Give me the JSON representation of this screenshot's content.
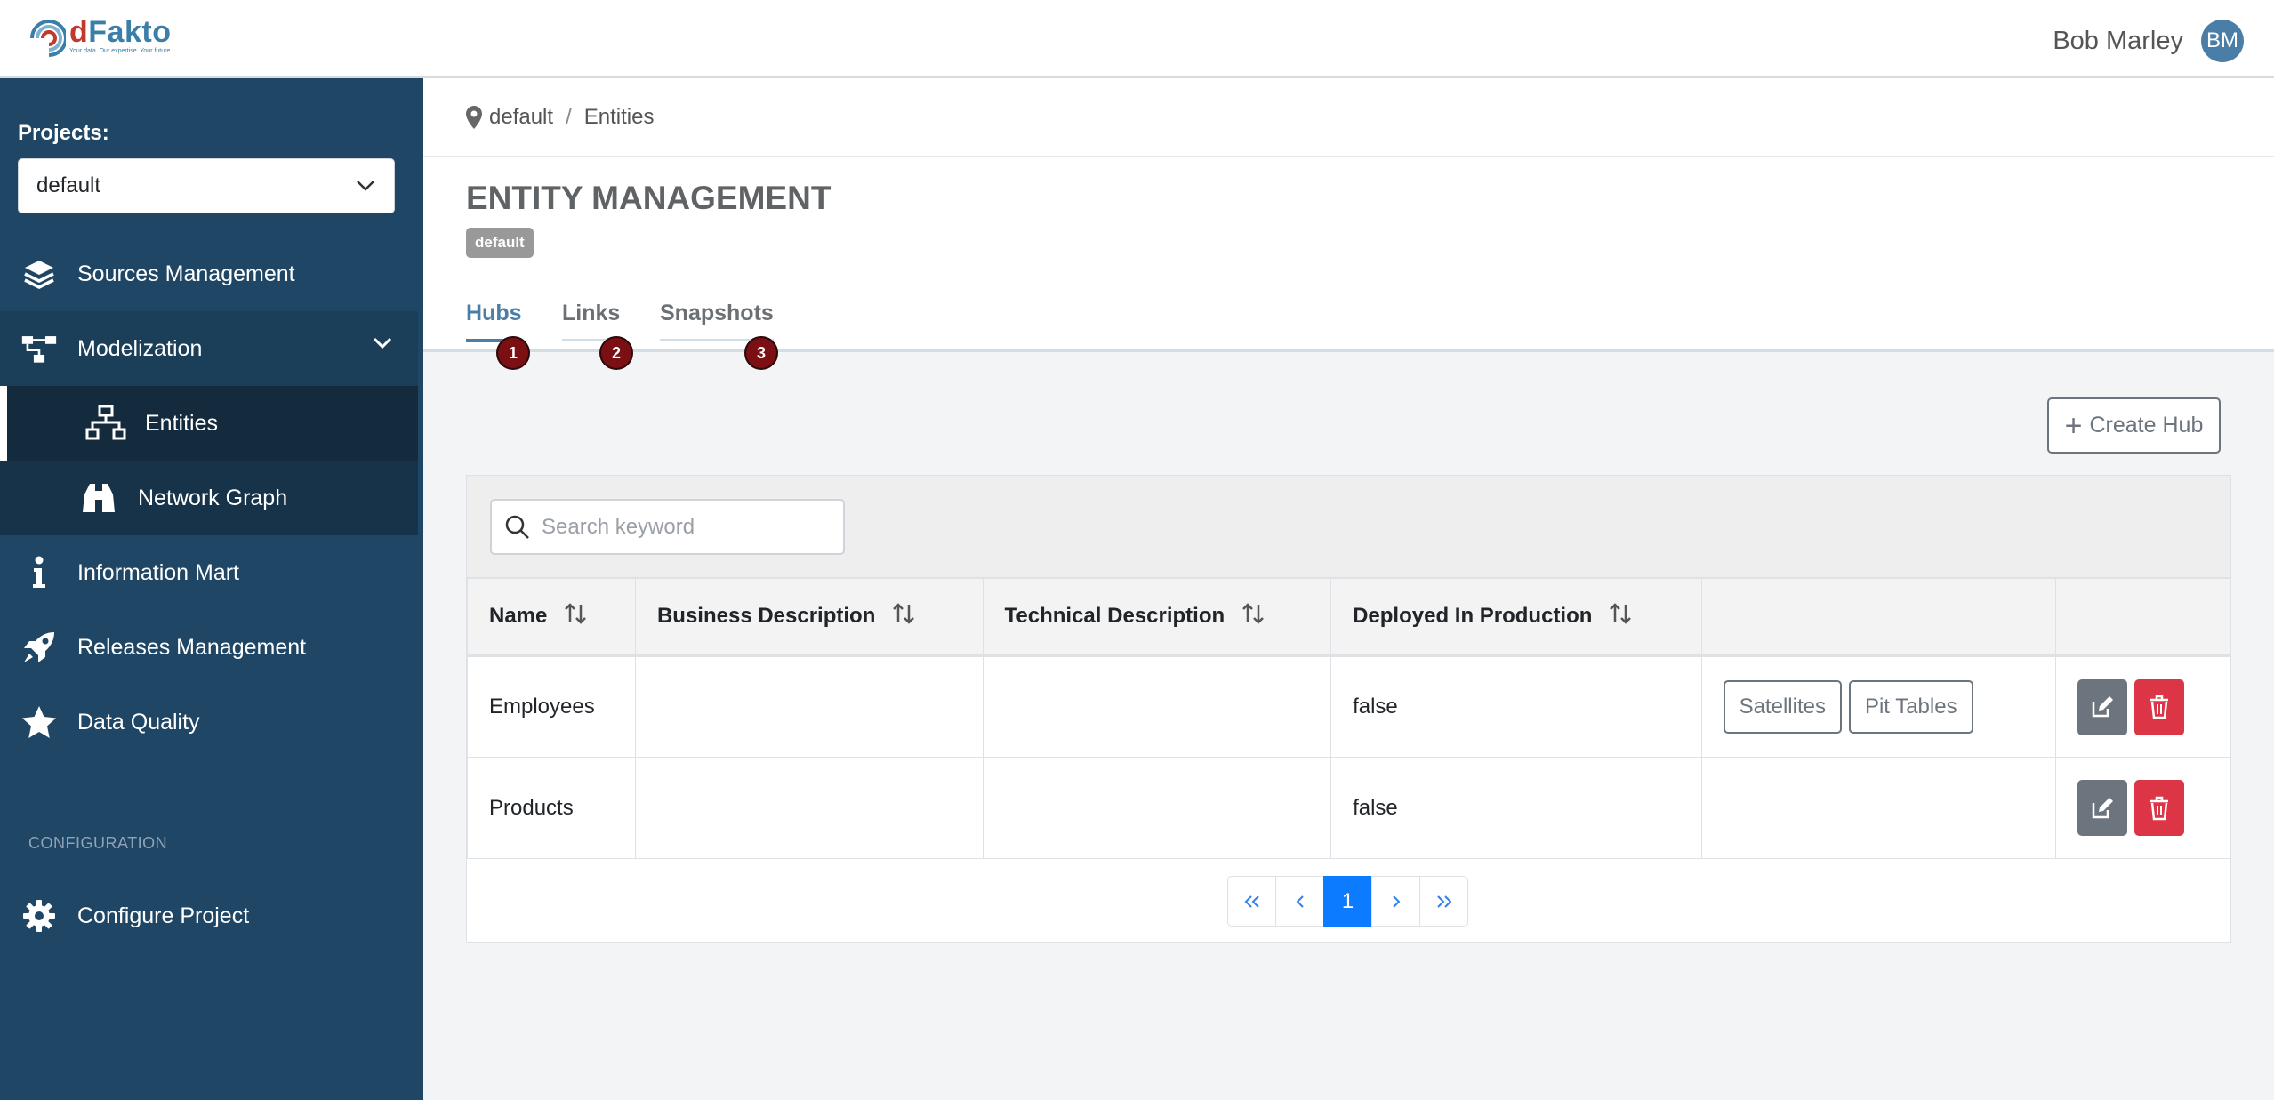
{
  "app": {
    "brand": "dFakto",
    "brand_initial": "d",
    "brand_rest": "Fakto",
    "tagline": "Your data. Our expertise. Your future."
  },
  "user": {
    "name": "Bob Marley",
    "initials": "BM"
  },
  "sidebar": {
    "projects_label": "Projects:",
    "project_selected": "default",
    "items": [
      {
        "label": "Sources Management",
        "icon": "layers-icon"
      },
      {
        "label": "Modelization",
        "icon": "flow-icon",
        "expanded": true
      },
      {
        "label": "Entities",
        "icon": "sitemap-icon",
        "active": true
      },
      {
        "label": "Network Graph",
        "icon": "binoculars-icon"
      },
      {
        "label": "Information Mart",
        "icon": "info-icon"
      },
      {
        "label": "Releases Management",
        "icon": "rocket-icon"
      },
      {
        "label": "Data Quality",
        "icon": "star-icon"
      }
    ],
    "config_label": "CONFIGURATION",
    "configure_project": "Configure Project"
  },
  "breadcrumb": {
    "project": "default",
    "separator": "/",
    "page": "Entities"
  },
  "page": {
    "title": "ENTITY MANAGEMENT",
    "project_badge": "default",
    "tabs": [
      {
        "label": "Hubs",
        "badge": "1",
        "active": true
      },
      {
        "label": "Links",
        "badge": "2"
      },
      {
        "label": "Snapshots",
        "badge": "3"
      }
    ],
    "create_button": "Create Hub"
  },
  "search": {
    "placeholder": "Search keyword",
    "value": ""
  },
  "table": {
    "headers": [
      "Name",
      "Business Description",
      "Technical Description",
      "Deployed In Production"
    ],
    "rows": [
      {
        "name": "Employees",
        "business": "",
        "technical": "",
        "deployed": "false",
        "links": [
          "Satellites",
          "Pit Tables"
        ]
      },
      {
        "name": "Products",
        "business": "",
        "technical": "",
        "deployed": "false",
        "links": []
      }
    ]
  },
  "pagination": {
    "first": "«",
    "prev": "‹",
    "current": "1",
    "next": "›",
    "last": "»"
  },
  "colors": {
    "sidebar": "#1f4664",
    "accent": "#4a7ea6",
    "danger": "#dc3545",
    "badge": "#7a0f14",
    "page_active": "#0d7bff"
  }
}
